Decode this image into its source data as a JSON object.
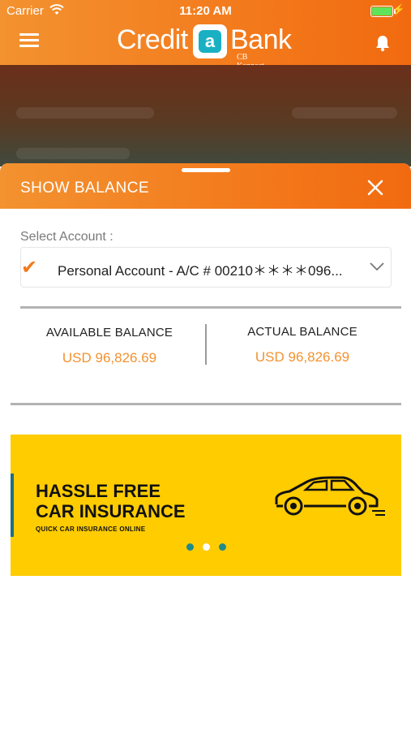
{
  "status_bar": {
    "carrier": "Carrier",
    "time": "11:20 AM"
  },
  "header": {
    "logo_word1": "Credit",
    "logo_mark": "a",
    "logo_word2": "Bank",
    "logo_sub": "CB Konnect",
    "menu_icon": "hamburger-menu-icon",
    "notification_icon": "bell-icon"
  },
  "sheet": {
    "title": "SHOW BALANCE",
    "close_icon": "close-icon",
    "select_label": "Select Account :",
    "selected_account": "Personal Account - A/C # 00210＊＊＊＊096...",
    "balances": {
      "available_label": "AVAILABLE BALANCE",
      "available_value": "USD 96,826.69",
      "actual_label": "ACTUAL BALANCE",
      "actual_value": "USD 96,826.69"
    }
  },
  "banner": {
    "line1": "HASSLE FREE",
    "line2": "CAR INSURANCE",
    "tagline": "QUICK CAR INSURANCE ONLINE",
    "pagination": {
      "total": 3,
      "active_index": 1
    }
  },
  "colors": {
    "accent": "#f37a1c",
    "amount": "#f39230",
    "banner": "#ffcc00",
    "teal": "#1ab0c3"
  }
}
